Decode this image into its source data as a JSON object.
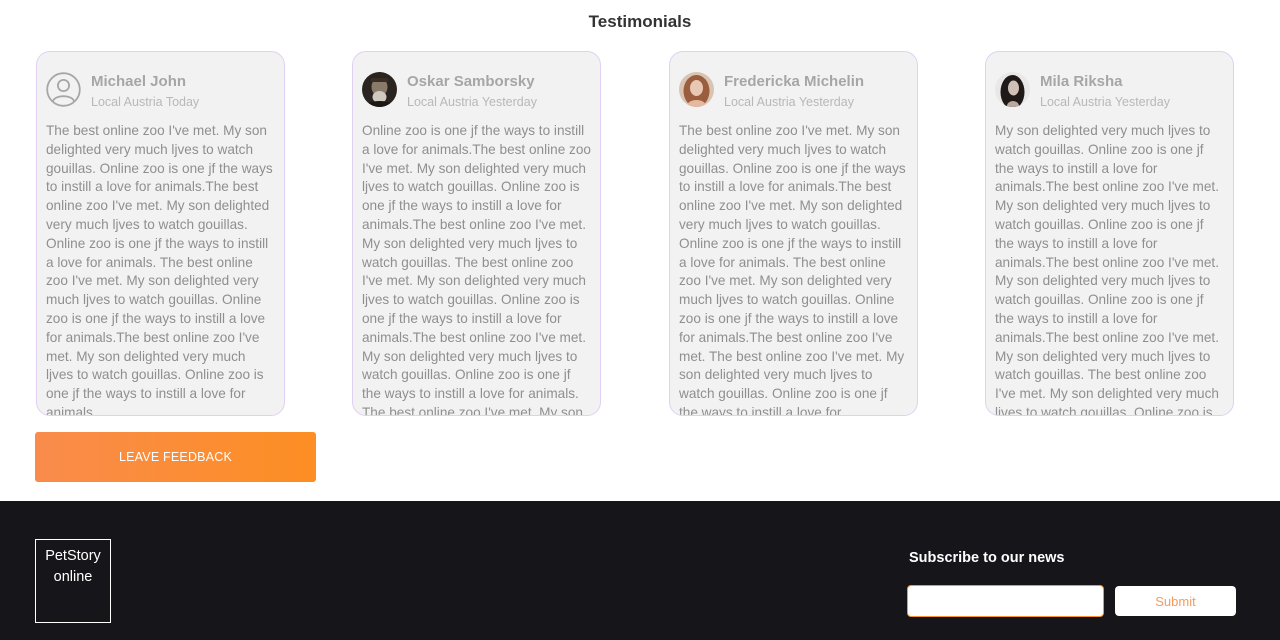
{
  "testimonials": {
    "title": "Testimonials",
    "cards": [
      {
        "name": "Michael John",
        "meta": "Local Austria Today",
        "avatar": "user-placeholder-icon",
        "text": "The best online zoo I've met. My son delighted very much ljves to watch gouillas. Online zoo is one jf the ways to instill a love for animals.The best online zoo I've met. My son delighted very much ljves to watch gouillas. Online zoo is one jf the ways to instill a love for animals. The best online zoo I've met. My son delighted very much ljves to watch gouillas. Online zoo is one jf the ways to instill a love for animals.The best online zoo I've met. My son delighted very much ljves to watch gouillas. Online zoo is one jf the ways to instill a love for animals."
      },
      {
        "name": "Oskar Samborsky",
        "meta": "Local Austria Yesterday",
        "avatar": "avatar-photo",
        "text": "Online zoo is one jf the ways to instill a love for animals.The best online zoo I've met. My son delighted very much ljves to watch gouillas. Online zoo is one jf the ways to instill a love for animals.The best online zoo I've met. My son delighted very much ljves to watch gouillas. The best online zoo I've met. My son delighted very much ljves to watch gouillas. Online zoo is one jf the ways to instill a love for animals.The best online zoo I've met. My son delighted very much ljves to watch gouillas. Online zoo is one jf the ways to instill a love for animals. The best online zoo I've met. My son delighted very much ljves to watch gouillas."
      },
      {
        "name": "Fredericka Michelin",
        "meta": "Local Austria Yesterday",
        "avatar": "avatar-photo",
        "text": "The best online zoo I've met. My son delighted very much ljves to watch gouillas. Online zoo is one jf the ways to instill a love for animals.The best online zoo I've met. My son delighted very much ljves to watch gouillas. Online zoo is one jf the ways to instill a love for animals. The best online zoo I've met. My son delighted very much ljves to watch gouillas. Online zoo is one jf the ways to instill a love for animals.The best online zoo I've met. The best online zoo I've met. My son delighted very much ljves to watch gouillas. Online zoo is one jf the ways to instill a love for animals.The best online zoo I've met."
      },
      {
        "name": "Mila Riksha",
        "meta": "Local Austria Yesterday",
        "avatar": "avatar-photo",
        "text": "My son delighted very much ljves to watch gouillas. Online zoo is one jf the ways to instill a love for animals.The best online zoo I've met. My son delighted very much ljves to watch gouillas. Online zoo is one jf the ways to instill a love for animals.The best online zoo I've met. My son delighted very much ljves to watch gouillas. Online zoo is one jf the ways to instill a love for animals.The best online zoo I've met. My son delighted very much ljves to watch gouillas. The best online zoo I've met. My son delighted very much ljves to watch gouillas. Online zoo is one jf the ways to instill a love for animals."
      }
    ],
    "feedback_button": "LEAVE FEEDBACK"
  },
  "footer": {
    "logo_line1": "PetStory",
    "logo_line2": "online",
    "subscribe_title": "Subscribe to our news",
    "email_value": "",
    "submit_label": "Submit"
  },
  "colors": {
    "accent": "#fd8e23",
    "card_border": "#e0d0f4",
    "card_bg": "#f1f2f1",
    "footer_bg": "#16161a"
  }
}
